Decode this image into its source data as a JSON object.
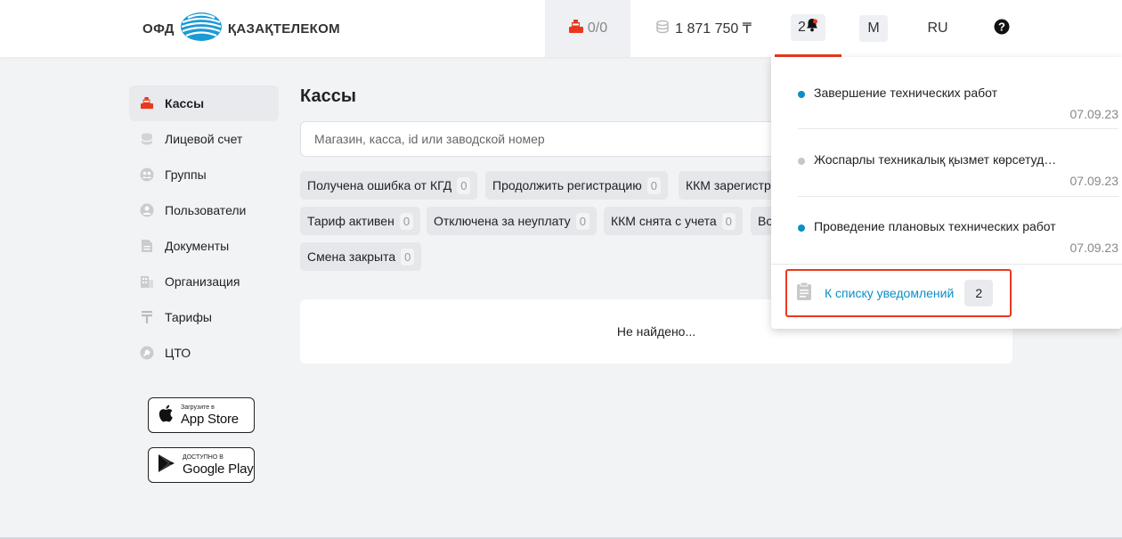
{
  "header": {
    "logo_left": "ОФД",
    "logo_brand": "ҚАЗАҚТЕЛЕКОМ",
    "kkm_counter": "0/0",
    "balance": "1 871 750 ₸",
    "notifications_count": "2",
    "user_initial": "M",
    "language": "RU",
    "accent_color": "#e8391d"
  },
  "sidebar": {
    "items": [
      {
        "label": "Кассы",
        "icon": "cash-register-icon"
      },
      {
        "label": "Лицевой счет",
        "icon": "coins-icon"
      },
      {
        "label": "Группы",
        "icon": "group-icon"
      },
      {
        "label": "Пользователи",
        "icon": "user-icon"
      },
      {
        "label": "Документы",
        "icon": "document-icon"
      },
      {
        "label": "Организация",
        "icon": "building-icon"
      },
      {
        "label": "Тарифы",
        "icon": "tenge-icon"
      },
      {
        "label": "ЦТО",
        "icon": "wrench-icon"
      }
    ],
    "appstore_small": "Загрузите в",
    "appstore_big": "App Store",
    "gplay_small": "ДОСТУПНО В",
    "gplay_big": "Google Play"
  },
  "main": {
    "title": "Кассы",
    "search_placeholder": "Магазин, касса, id или заводской номер",
    "filters": [
      {
        "label": "Получена ошибка от КГД",
        "count": "0"
      },
      {
        "label": "Продолжить регистрацию",
        "count": "0"
      },
      {
        "label": "ККМ зарегистр",
        "count": ""
      },
      {
        "label": "Тариф активен",
        "count": "0"
      },
      {
        "label": "Отключена за неуплату",
        "count": "0"
      },
      {
        "label": "ККМ снята с учета",
        "count": "0"
      },
      {
        "label": "Во",
        "count": ""
      },
      {
        "label": "Смена закрыта",
        "count": "0"
      }
    ],
    "empty_text": "Не найдено..."
  },
  "notifications": {
    "items": [
      {
        "title": "Завершение технических работ",
        "date": "07.09.23",
        "unread": true
      },
      {
        "title": "Жоспарлы техникалық қызмет көрсетуд…",
        "date": "07.09.23",
        "unread": false
      },
      {
        "title": "Проведение плановых технических работ",
        "date": "07.09.23",
        "unread": true
      }
    ],
    "to_list_label": "К списку уведомлений",
    "to_list_count": "2",
    "unread_color": "#0a8fc7",
    "read_color": "#c8c8c0"
  }
}
